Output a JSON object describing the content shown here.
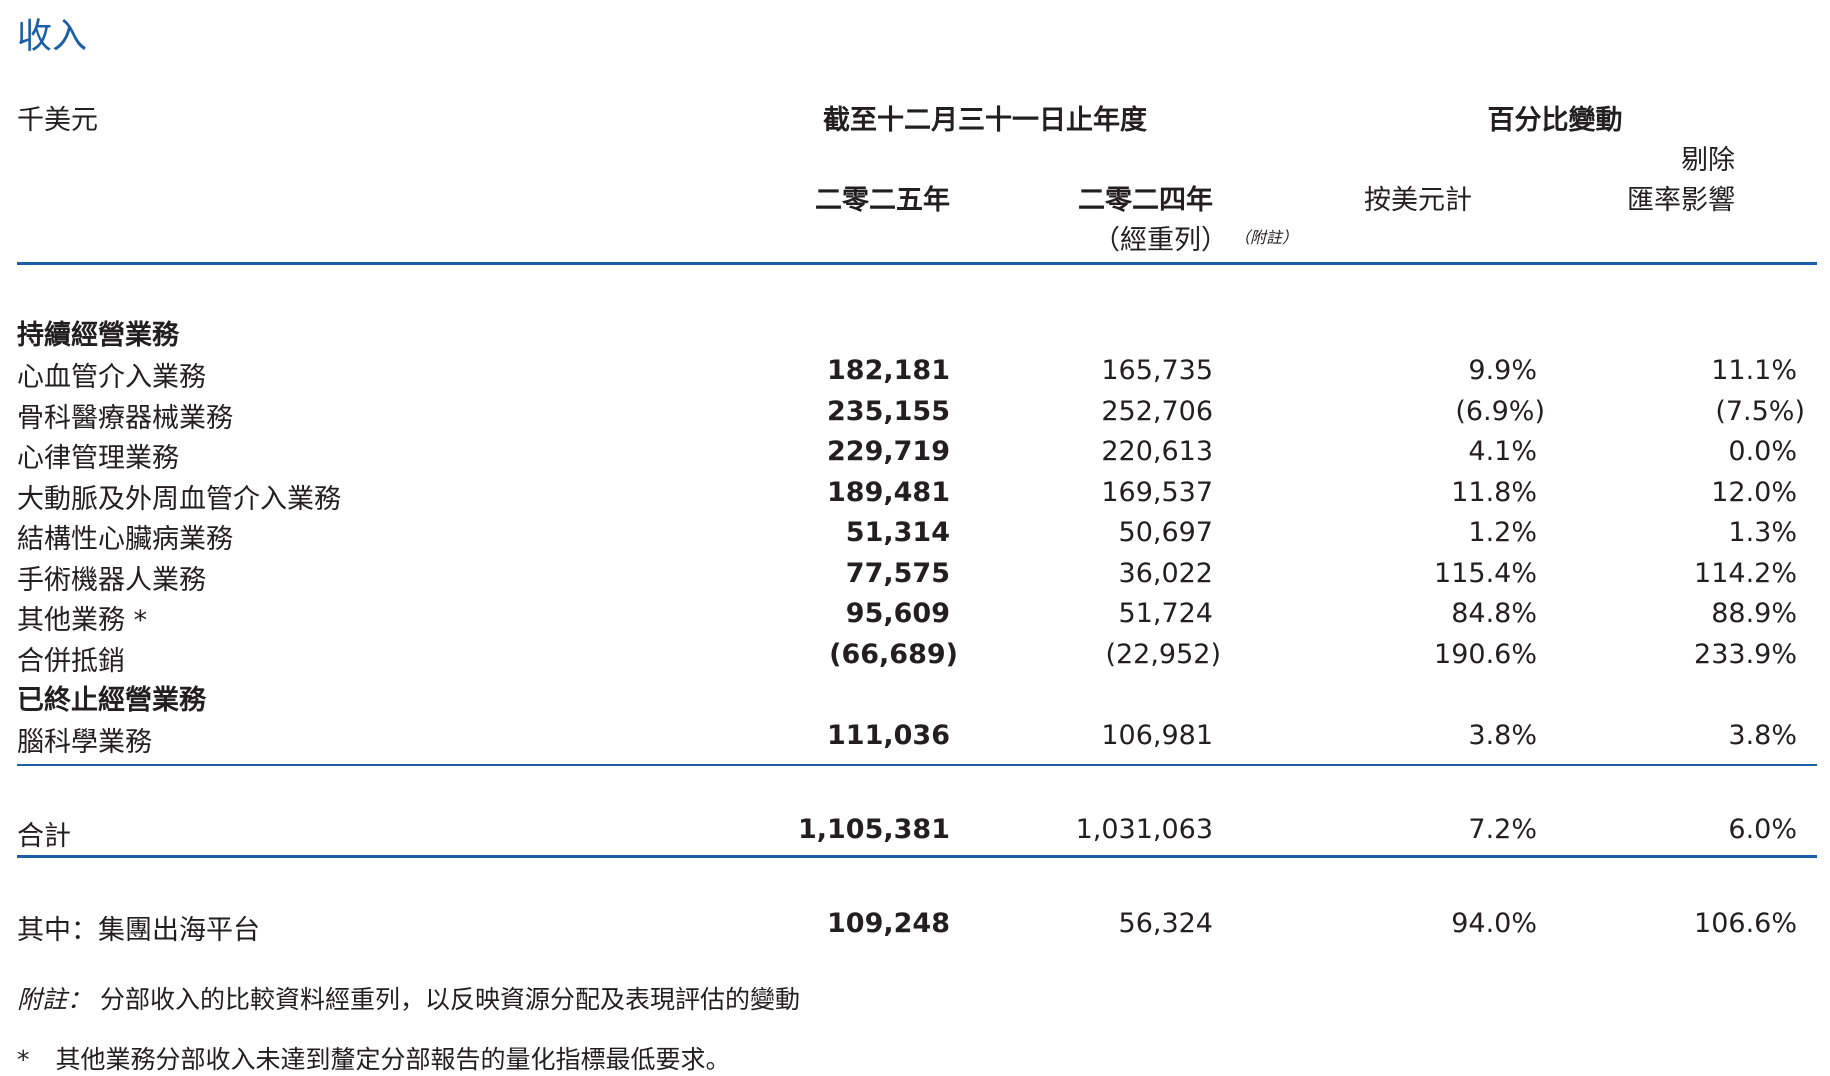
{
  "title": "收入",
  "unit": "千美元",
  "header": {
    "period": "截至十二月三十一日止年度",
    "pct_change": "百分比變動",
    "year_2025": "二零二五年",
    "year_2024": "二零二四年",
    "year_2024_sub": "（經重列）",
    "year_2024_note": "（附註）",
    "usd_basis": "按美元計",
    "ex_fx_line1": "剔除",
    "ex_fx_line2": "匯率影響"
  },
  "sections": {
    "continuing": "持續經營業務",
    "discontinued": "已終止經營業務"
  },
  "rows": [
    {
      "label": "心血管介入業務",
      "v2025": "182,181",
      "v2024": "165,735",
      "pct_usd": "9.9%",
      "pct_exfx": "11.1%"
    },
    {
      "label": "骨科醫療器械業務",
      "v2025": "235,155",
      "v2024": "252,706",
      "pct_usd": "(6.9%)",
      "pct_exfx": "(7.5%)"
    },
    {
      "label": "心律管理業務",
      "v2025": "229,719",
      "v2024": "220,613",
      "pct_usd": "4.1%",
      "pct_exfx": "0.0%"
    },
    {
      "label": "大動脈及外周血管介入業務",
      "v2025": "189,481",
      "v2024": "169,537",
      "pct_usd": "11.8%",
      "pct_exfx": "12.0%"
    },
    {
      "label": "結構性心臟病業務",
      "v2025": "51,314",
      "v2024": "50,697",
      "pct_usd": "1.2%",
      "pct_exfx": "1.3%"
    },
    {
      "label": "手術機器人業務",
      "v2025": "77,575",
      "v2024": "36,022",
      "pct_usd": "115.4%",
      "pct_exfx": "114.2%"
    },
    {
      "label": "其他業務 *",
      "v2025": "95,609",
      "v2024": "51,724",
      "pct_usd": "84.8%",
      "pct_exfx": "88.9%"
    },
    {
      "label": "合併抵銷",
      "v2025": "(66,689)",
      "v2024": "(22,952)",
      "pct_usd": "190.6%",
      "pct_exfx": "233.9%"
    }
  ],
  "discontinued_row": {
    "label": "腦科學業務",
    "v2025": "111,036",
    "v2024": "106,981",
    "pct_usd": "3.8%",
    "pct_exfx": "3.8%"
  },
  "total": {
    "label": "合計",
    "v2025": "1,105,381",
    "v2024": "1,031,063",
    "pct_usd": "7.2%",
    "pct_exfx": "6.0%"
  },
  "of_which": {
    "label": "其中：集團出海平台",
    "v2025": "109,248",
    "v2024": "56,324",
    "pct_usd": "94.0%",
    "pct_exfx": "106.6%"
  },
  "notes": {
    "note_label": "附註：",
    "note_text": "分部收入的比較資料經重列，以反映資源分配及表現評估的變動",
    "star_mark": "*",
    "star_text": "其他業務分部收入未達到釐定分部報告的量化指標最低要求。"
  },
  "colors": {
    "accent": "#1a5fa8",
    "text": "#231f20"
  }
}
